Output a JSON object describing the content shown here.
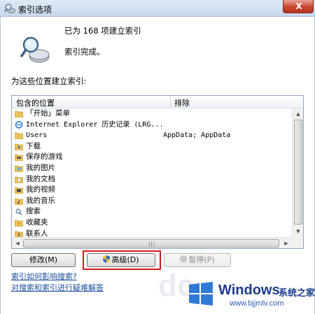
{
  "window": {
    "title": "索引选项",
    "close_label": "X"
  },
  "header": {
    "count_text": "已为 168 项建立索引",
    "status_text": "索引完成。",
    "section_label": "为这些位置建立索引:"
  },
  "listview": {
    "col_included": "包含的位置",
    "col_exclude": "排除",
    "rows": [
      {
        "name": "「开始」菜单",
        "exclude": "",
        "icon": "folder-icon"
      },
      {
        "name": "Internet Explorer 历史记录 (LRG...",
        "exclude": "",
        "icon": "ie-icon"
      },
      {
        "name": "Users",
        "exclude": "AppData; AppData",
        "icon": "folder-icon"
      },
      {
        "name": "下载",
        "exclude": "",
        "icon": "download-folder-icon"
      },
      {
        "name": "保存的游戏",
        "exclude": "",
        "icon": "games-folder-icon"
      },
      {
        "name": "我的图片",
        "exclude": "",
        "icon": "pictures-folder-icon"
      },
      {
        "name": "我的文档",
        "exclude": "",
        "icon": "documents-folder-icon"
      },
      {
        "name": "我的视频",
        "exclude": "",
        "icon": "videos-folder-icon"
      },
      {
        "name": "我的音乐",
        "exclude": "",
        "icon": "music-folder-icon"
      },
      {
        "name": "搜索",
        "exclude": "",
        "icon": "search-folder-icon"
      },
      {
        "name": "收藏夹",
        "exclude": "",
        "icon": "favorites-folder-icon"
      },
      {
        "name": "联系人",
        "exclude": "",
        "icon": "contacts-folder-icon"
      }
    ]
  },
  "buttons": {
    "modify": "修改(M)",
    "advanced": "高级(D)",
    "pause": "暂停(P)"
  },
  "links": {
    "how_index": "索引如何影响搜索?",
    "troubleshoot": "对搜索和索引进行疑难解答"
  },
  "watermark": {
    "brand": "Windows",
    "brand_cn": "系统之家",
    "url": "www.bjjmlv.com",
    "bg_letters": "dc"
  },
  "colors": {
    "highlight": "#d11a1a",
    "link": "#1a4fa0",
    "titlebar": "#c8d8ec"
  }
}
